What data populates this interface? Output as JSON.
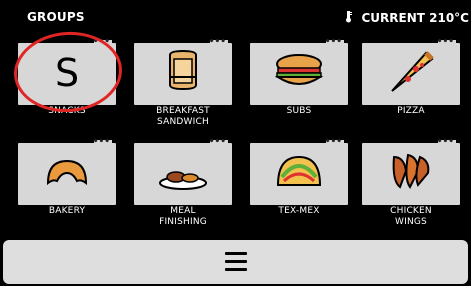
{
  "header": {
    "title": "GROUPS",
    "temperature": "CURRENT 210°C",
    "temperature_icon": "thermometer-icon"
  },
  "groups": [
    {
      "label": "SNACKS",
      "icon": "letter-s",
      "letter": "S",
      "selected": true
    },
    {
      "label": "BREAKFAST SANDWICH",
      "line1": "BREAKFAST",
      "line2": "SANDWICH",
      "icon": "sandwich-icon"
    },
    {
      "label": "SUBS",
      "icon": "sub-sandwich-icon"
    },
    {
      "label": "PIZZA",
      "icon": "pizza-slice-icon"
    },
    {
      "label": "BAKERY",
      "icon": "croissant-icon"
    },
    {
      "label": "MEAL FINISHING",
      "line1": "MEAL",
      "line2": "FINISHING",
      "icon": "meal-plate-icon"
    },
    {
      "label": "TEX-MEX",
      "icon": "taco-icon"
    },
    {
      "label": "CHICKEN WINGS",
      "line1": "CHICKEN",
      "line2": "WINGS",
      "icon": "chicken-wings-icon"
    }
  ],
  "tile_menu_glyph": "•••",
  "footer": {
    "menu_icon": "hamburger-menu-icon"
  },
  "colors": {
    "background": "#000000",
    "card": "#d7d7d7",
    "highlight": "#e02525",
    "footer": "#dedede"
  }
}
